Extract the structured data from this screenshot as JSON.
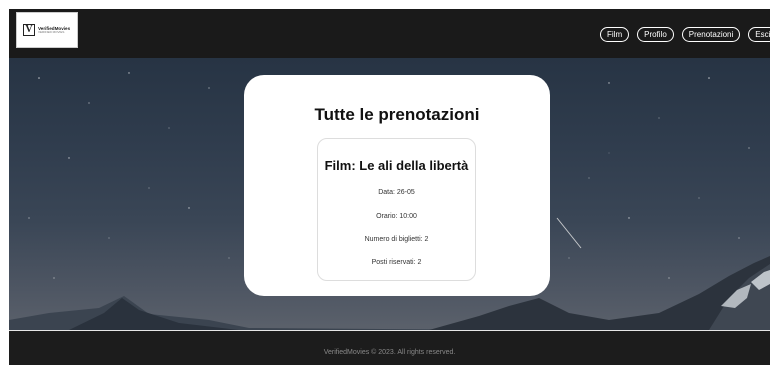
{
  "header": {
    "logo": {
      "mark": "V",
      "name": "VerifiedMovies",
      "tagline": "VERIFIED MOVIES"
    },
    "nav": [
      {
        "id": "film",
        "label": "Film"
      },
      {
        "id": "profilo",
        "label": "Profilo"
      },
      {
        "id": "prenotazioni",
        "label": "Prenotazioni"
      },
      {
        "id": "esci",
        "label": "Esci"
      }
    ]
  },
  "main": {
    "title": "Tutte le prenotazioni",
    "bookings": [
      {
        "film": "Film: Le ali della libertà",
        "data": "Data: 26-05",
        "orario": "Orario: 10:00",
        "biglietti": "Numero di biglietti: 2",
        "posti": "Posti riservati: 2"
      }
    ]
  },
  "footer": {
    "text": "VerifiedMovies © 2023. All rights reserved."
  },
  "colors": {
    "header_bg": "#1a1a1a",
    "footer_bg": "#1c1c1c",
    "card_bg": "#ffffff",
    "accent": "#ffffff"
  }
}
